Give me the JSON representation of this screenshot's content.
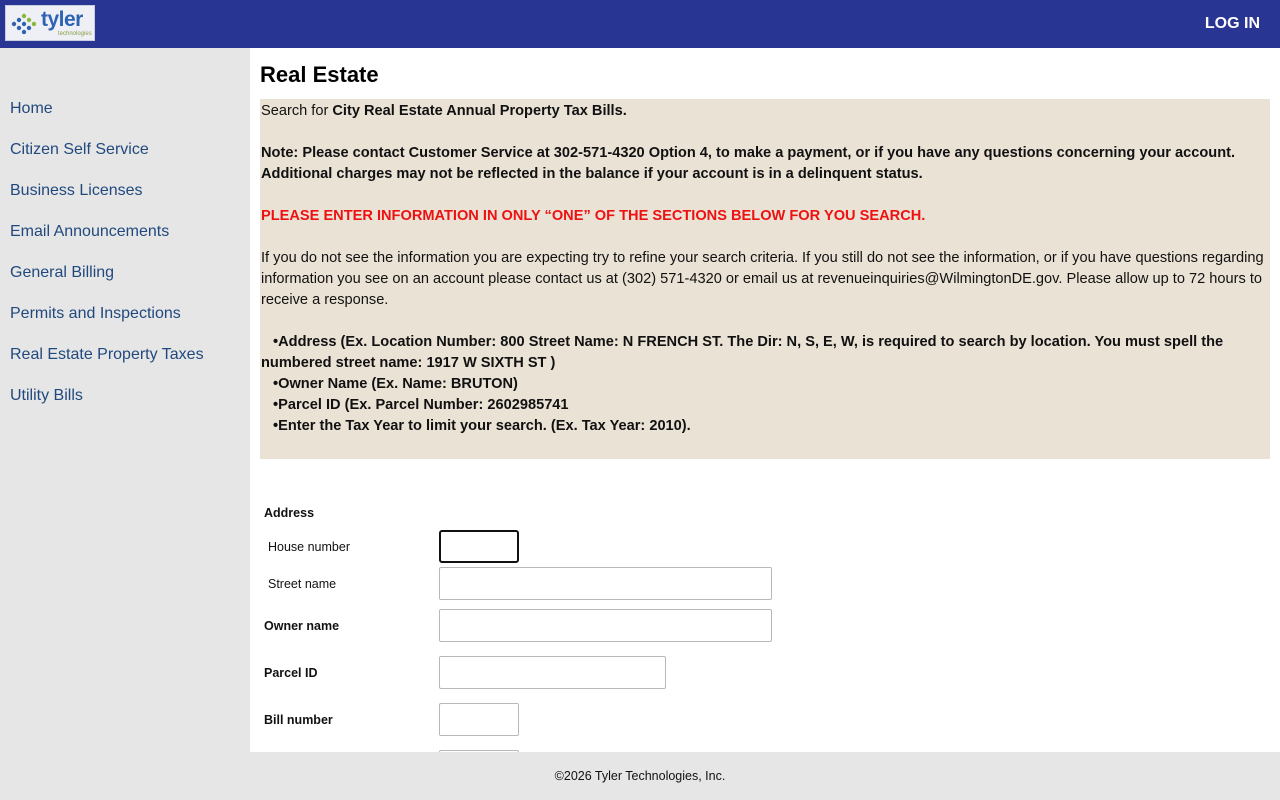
{
  "header": {
    "logo_text": "tyler",
    "logo_subtext": "technologies",
    "login_label": "LOG IN",
    "bar_color": "#283593"
  },
  "sidebar": {
    "items": [
      {
        "label": "Home"
      },
      {
        "label": "Citizen Self Service"
      },
      {
        "label": "Business Licenses"
      },
      {
        "label": "Email Announcements"
      },
      {
        "label": "General Billing"
      },
      {
        "label": "Permits and Inspections"
      },
      {
        "label": "Real Estate Property Taxes"
      },
      {
        "label": "Utility Bills"
      }
    ]
  },
  "main": {
    "title": "Real Estate",
    "notice": {
      "search_prefix": "Search for ",
      "search_bold": "City Real Estate Annual Property Tax Bills.",
      "note": "Note: Please contact Customer Service at 302-571-4320 Option 4, to make a payment, or if you have any questions concerning your account. Additional charges may not be reflected in the balance if your account is in a delinquent status.",
      "warning": "PLEASE ENTER INFORMATION IN ONLY “ONE” OF THE SECTIONS BELOW FOR YOU SEARCH.",
      "help": "If you do not see the information you are expecting try to refine your search criteria. If you still do not see the information, or if you have questions regarding information you see on an account please contact us at (302) 571-4320 or email us at revenueinquiries@WilmingtonDE.gov. Please allow up to 72 hours to receive a response.",
      "bullets": [
        "•Address (Ex. Location Number: 800 Street Name: N FRENCH ST. The Dir: N, S, E, W, is required to search by location. You must spell the numbered street name: 1917 W SIXTH ST )",
        "•Owner Name (Ex. Name: BRUTON)",
        "•Parcel ID (Ex. Parcel Number: 2602985741",
        "•Enter the Tax Year to limit your search. (Ex. Tax Year: 2010)."
      ],
      "background_color": "#ebe2d6",
      "warning_color": "#ee1111"
    },
    "form": {
      "address_heading": "Address",
      "house_number_label": "House number",
      "house_number_value": "",
      "street_name_label": "Street name",
      "street_name_value": "",
      "owner_name_label": "Owner name",
      "owner_name_value": "",
      "parcel_id_label": "Parcel ID",
      "parcel_id_value": "",
      "bill_number_label": "Bill number",
      "bill_number_value": ""
    }
  },
  "footer": {
    "copyright": "©2026 Tyler Technologies, Inc."
  }
}
